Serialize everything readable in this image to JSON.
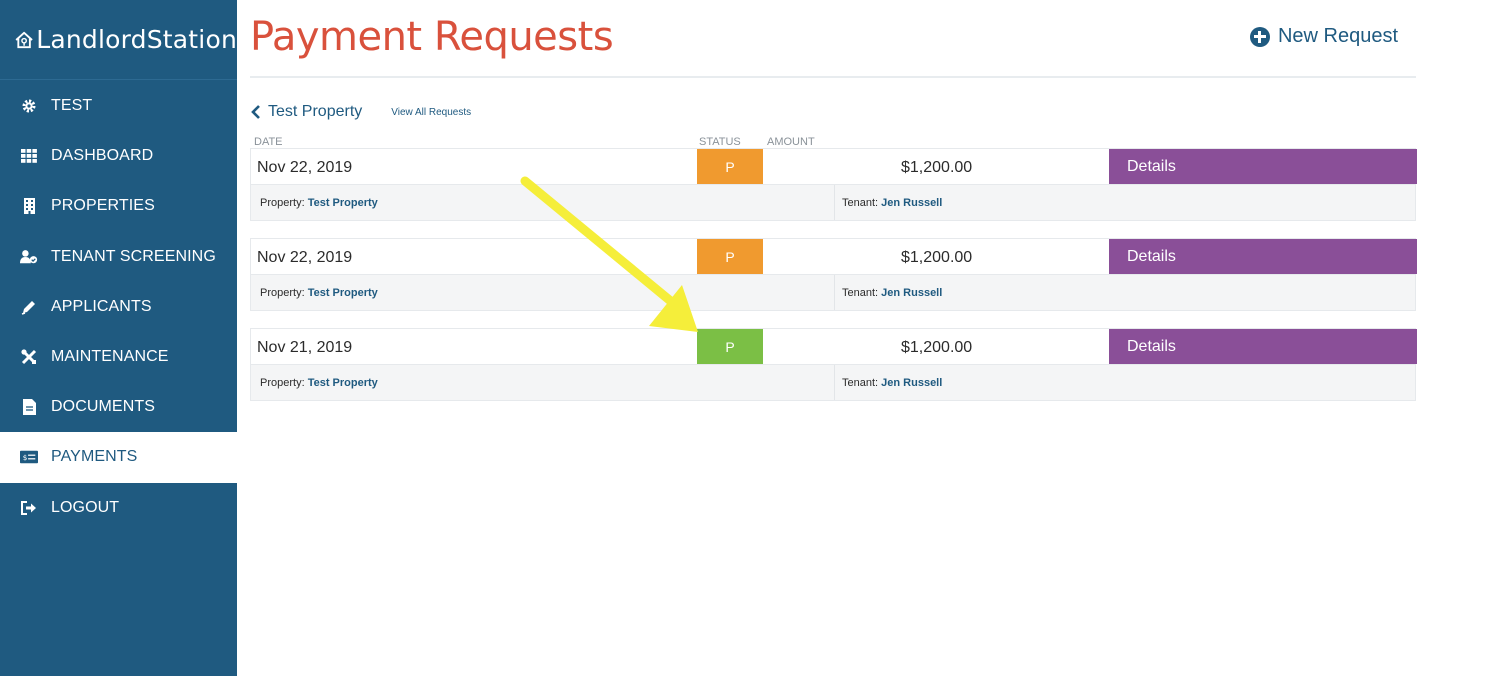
{
  "brand": {
    "name": "LandlordStation"
  },
  "colors": {
    "sidebar": "#1f5a80",
    "title": "#d9513c",
    "pending_orange": "#f09a2f",
    "paid_green": "#7bbf45",
    "details_purple": "#8a4f98",
    "arrow": "#f5ee3a"
  },
  "sidebar": {
    "items": [
      {
        "label": "TEST",
        "icon": "gear-icon",
        "active": false
      },
      {
        "label": "DASHBOARD",
        "icon": "grid-icon",
        "active": false
      },
      {
        "label": "PROPERTIES",
        "icon": "building-icon",
        "active": false
      },
      {
        "label": "TENANT SCREENING",
        "icon": "user-check-icon",
        "active": false
      },
      {
        "label": "APPLICANTS",
        "icon": "pen-icon",
        "active": false
      },
      {
        "label": "MAINTENANCE",
        "icon": "tools-icon",
        "active": false
      },
      {
        "label": "DOCUMENTS",
        "icon": "document-icon",
        "active": false
      },
      {
        "label": "PAYMENTS",
        "icon": "money-icon",
        "active": true
      },
      {
        "label": "LOGOUT",
        "icon": "logout-icon",
        "active": false
      }
    ]
  },
  "header": {
    "title": "Payment Requests",
    "new_request_label": "New Request"
  },
  "breadcrumb": {
    "property": "Test Property",
    "view_all": "View All Requests"
  },
  "columns": {
    "date": "DATE",
    "status": "STATUS",
    "amount": "AMOUNT"
  },
  "requests": [
    {
      "date": "Nov 22, 2019",
      "status": "P",
      "status_color": "#f09a2f",
      "amount": "$1,200.00",
      "details_label": "Details",
      "property_label": "Property:",
      "property": "Test Property",
      "tenant_label": "Tenant:",
      "tenant": "Jen Russell"
    },
    {
      "date": "Nov 22, 2019",
      "status": "P",
      "status_color": "#f09a2f",
      "amount": "$1,200.00",
      "details_label": "Details",
      "property_label": "Property:",
      "property": "Test Property",
      "tenant_label": "Tenant:",
      "tenant": "Jen Russell"
    },
    {
      "date": "Nov 21, 2019",
      "status": "P",
      "status_color": "#7bbf45",
      "amount": "$1,200.00",
      "details_label": "Details",
      "property_label": "Property:",
      "property": "Test Property",
      "tenant_label": "Tenant:",
      "tenant": "Jen Russell"
    }
  ]
}
